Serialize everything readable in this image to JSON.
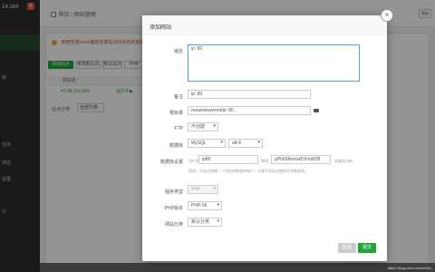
{
  "sidebar": {
    "server_ip": "14.164",
    "badge": "8",
    "items": [
      "库",
      "任务",
      "商店",
      "设置",
      "计"
    ]
  },
  "header": {
    "breadcrumb_home": "首页",
    "breadcrumb_sep": "/",
    "breadcrumb_current": "网站管理",
    "right_button": "网站"
  },
  "main": {
    "warning": "使用宝塔Linux面板创建站点时会自动创建权限配置",
    "buttons": [
      "添加站点",
      "修改默认页",
      "默认站点",
      "PHP"
    ],
    "table_col": "网站名",
    "row_site": "47.96.114.164",
    "row_status": "运行中▶",
    "category_label": "站点分类",
    "category_value": "全部分类"
  },
  "modal": {
    "title": "添加网站",
    "domain_label": "域名",
    "domain_value": "ip:  80",
    "remark_label": "备注",
    "remark_value": "ip:  80",
    "root_label": "根目录",
    "root_value": "/www/wwwroot/ip:  80",
    "ftp_label": "FTP",
    "ftp_value": "不创建",
    "db_label": "数据库",
    "db_type": "MySQL",
    "db_charset": "utf-8",
    "dbset_label": "数据库设置",
    "db_user_label": "用户名",
    "db_user_value": "ip80",
    "db_pass_label": "密码",
    "db_pass_value": "pPh658emxk5YmW2B",
    "db_pass_hint": "创建成功的",
    "db_note": "同时，为站点创建一个对应的数据库帐户，方便不同站点使用不同数据库。",
    "prog_label": "程序类型",
    "prog_value": "PHP",
    "php_label": "PHP版本",
    "php_value": "PHP-56",
    "cat_label": "网站分类",
    "cat_value": "默认分类",
    "cancel": "取消",
    "submit": "提交"
  },
  "watermark": "https://blog.csdn.net/weixin_"
}
